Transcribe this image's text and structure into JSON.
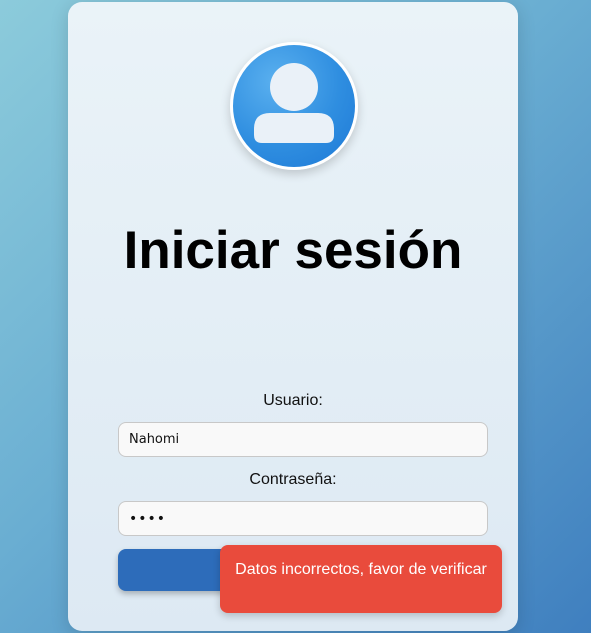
{
  "login": {
    "title": "Iniciar sesión",
    "username_label": "Usuario:",
    "username_value": "Nahomi",
    "password_label": "Contraseña:",
    "password_value": "••••"
  },
  "error": {
    "message": "Datos incorrectos, favor de verificar"
  },
  "icons": {
    "avatar": "user-avatar-icon"
  },
  "colors": {
    "error_bg": "#e94b3c",
    "primary_button": "#2d6cba",
    "secondary_button": "#4a9fb2",
    "avatar_blue": "#2f8ee0"
  }
}
